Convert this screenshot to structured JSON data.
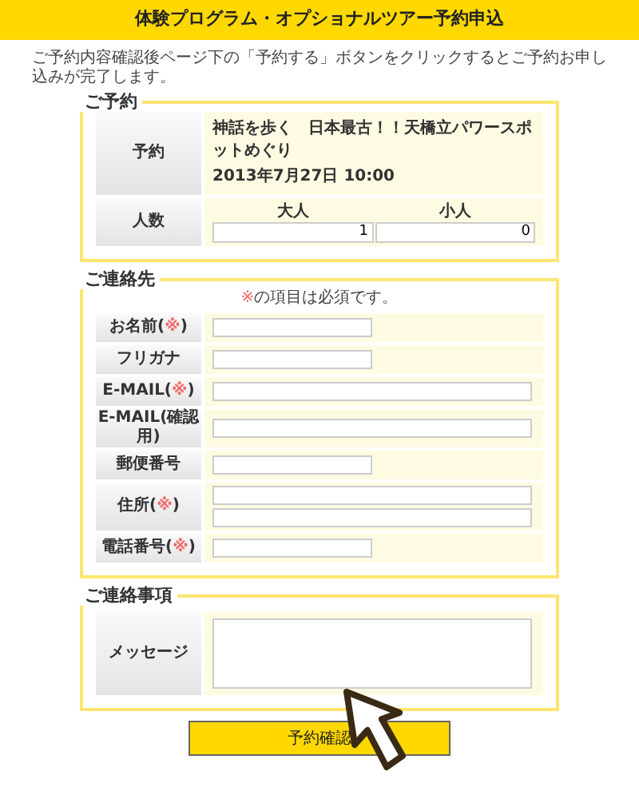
{
  "header": {
    "title": "体験プログラム・オプショナルツアー予約申込"
  },
  "intro": "ご予約内容確認後ページ下の「予約する」ボタンをクリックするとご予約お申し込みが完了します。",
  "reservation": {
    "legend": "ご予約",
    "plan_label": "予約",
    "plan_name": "神話を歩く　日本最古！！天橋立パワースポットめぐり",
    "plan_date": "2013年7月27日 10:00",
    "count_label": "人数",
    "counts": [
      {
        "label": "大人",
        "value": "1"
      },
      {
        "label": "小人",
        "value": "0"
      }
    ]
  },
  "contact": {
    "legend": "ご連絡先",
    "note": {
      "mark": "※",
      "text": "の項目は必須です。"
    },
    "rows": [
      {
        "label": "お名前(",
        "mark": "※",
        "label_end": ")",
        "kind": "short"
      },
      {
        "label": "フリガナ",
        "kind": "short"
      },
      {
        "label": "E-MAIL(",
        "mark": "※",
        "label_end": ")",
        "kind": "long"
      },
      {
        "label": "E-MAIL(確認用)",
        "kind": "long"
      },
      {
        "label": "郵便番号",
        "kind": "short"
      },
      {
        "label": "住所(",
        "mark": "※",
        "label_end": ")",
        "kind": "double"
      },
      {
        "label": "電話番号(",
        "mark": "※",
        "label_end": ")",
        "kind": "short"
      }
    ]
  },
  "message": {
    "legend": "ご連絡事項",
    "label": "メッセージ"
  },
  "submit": "予約確認"
}
